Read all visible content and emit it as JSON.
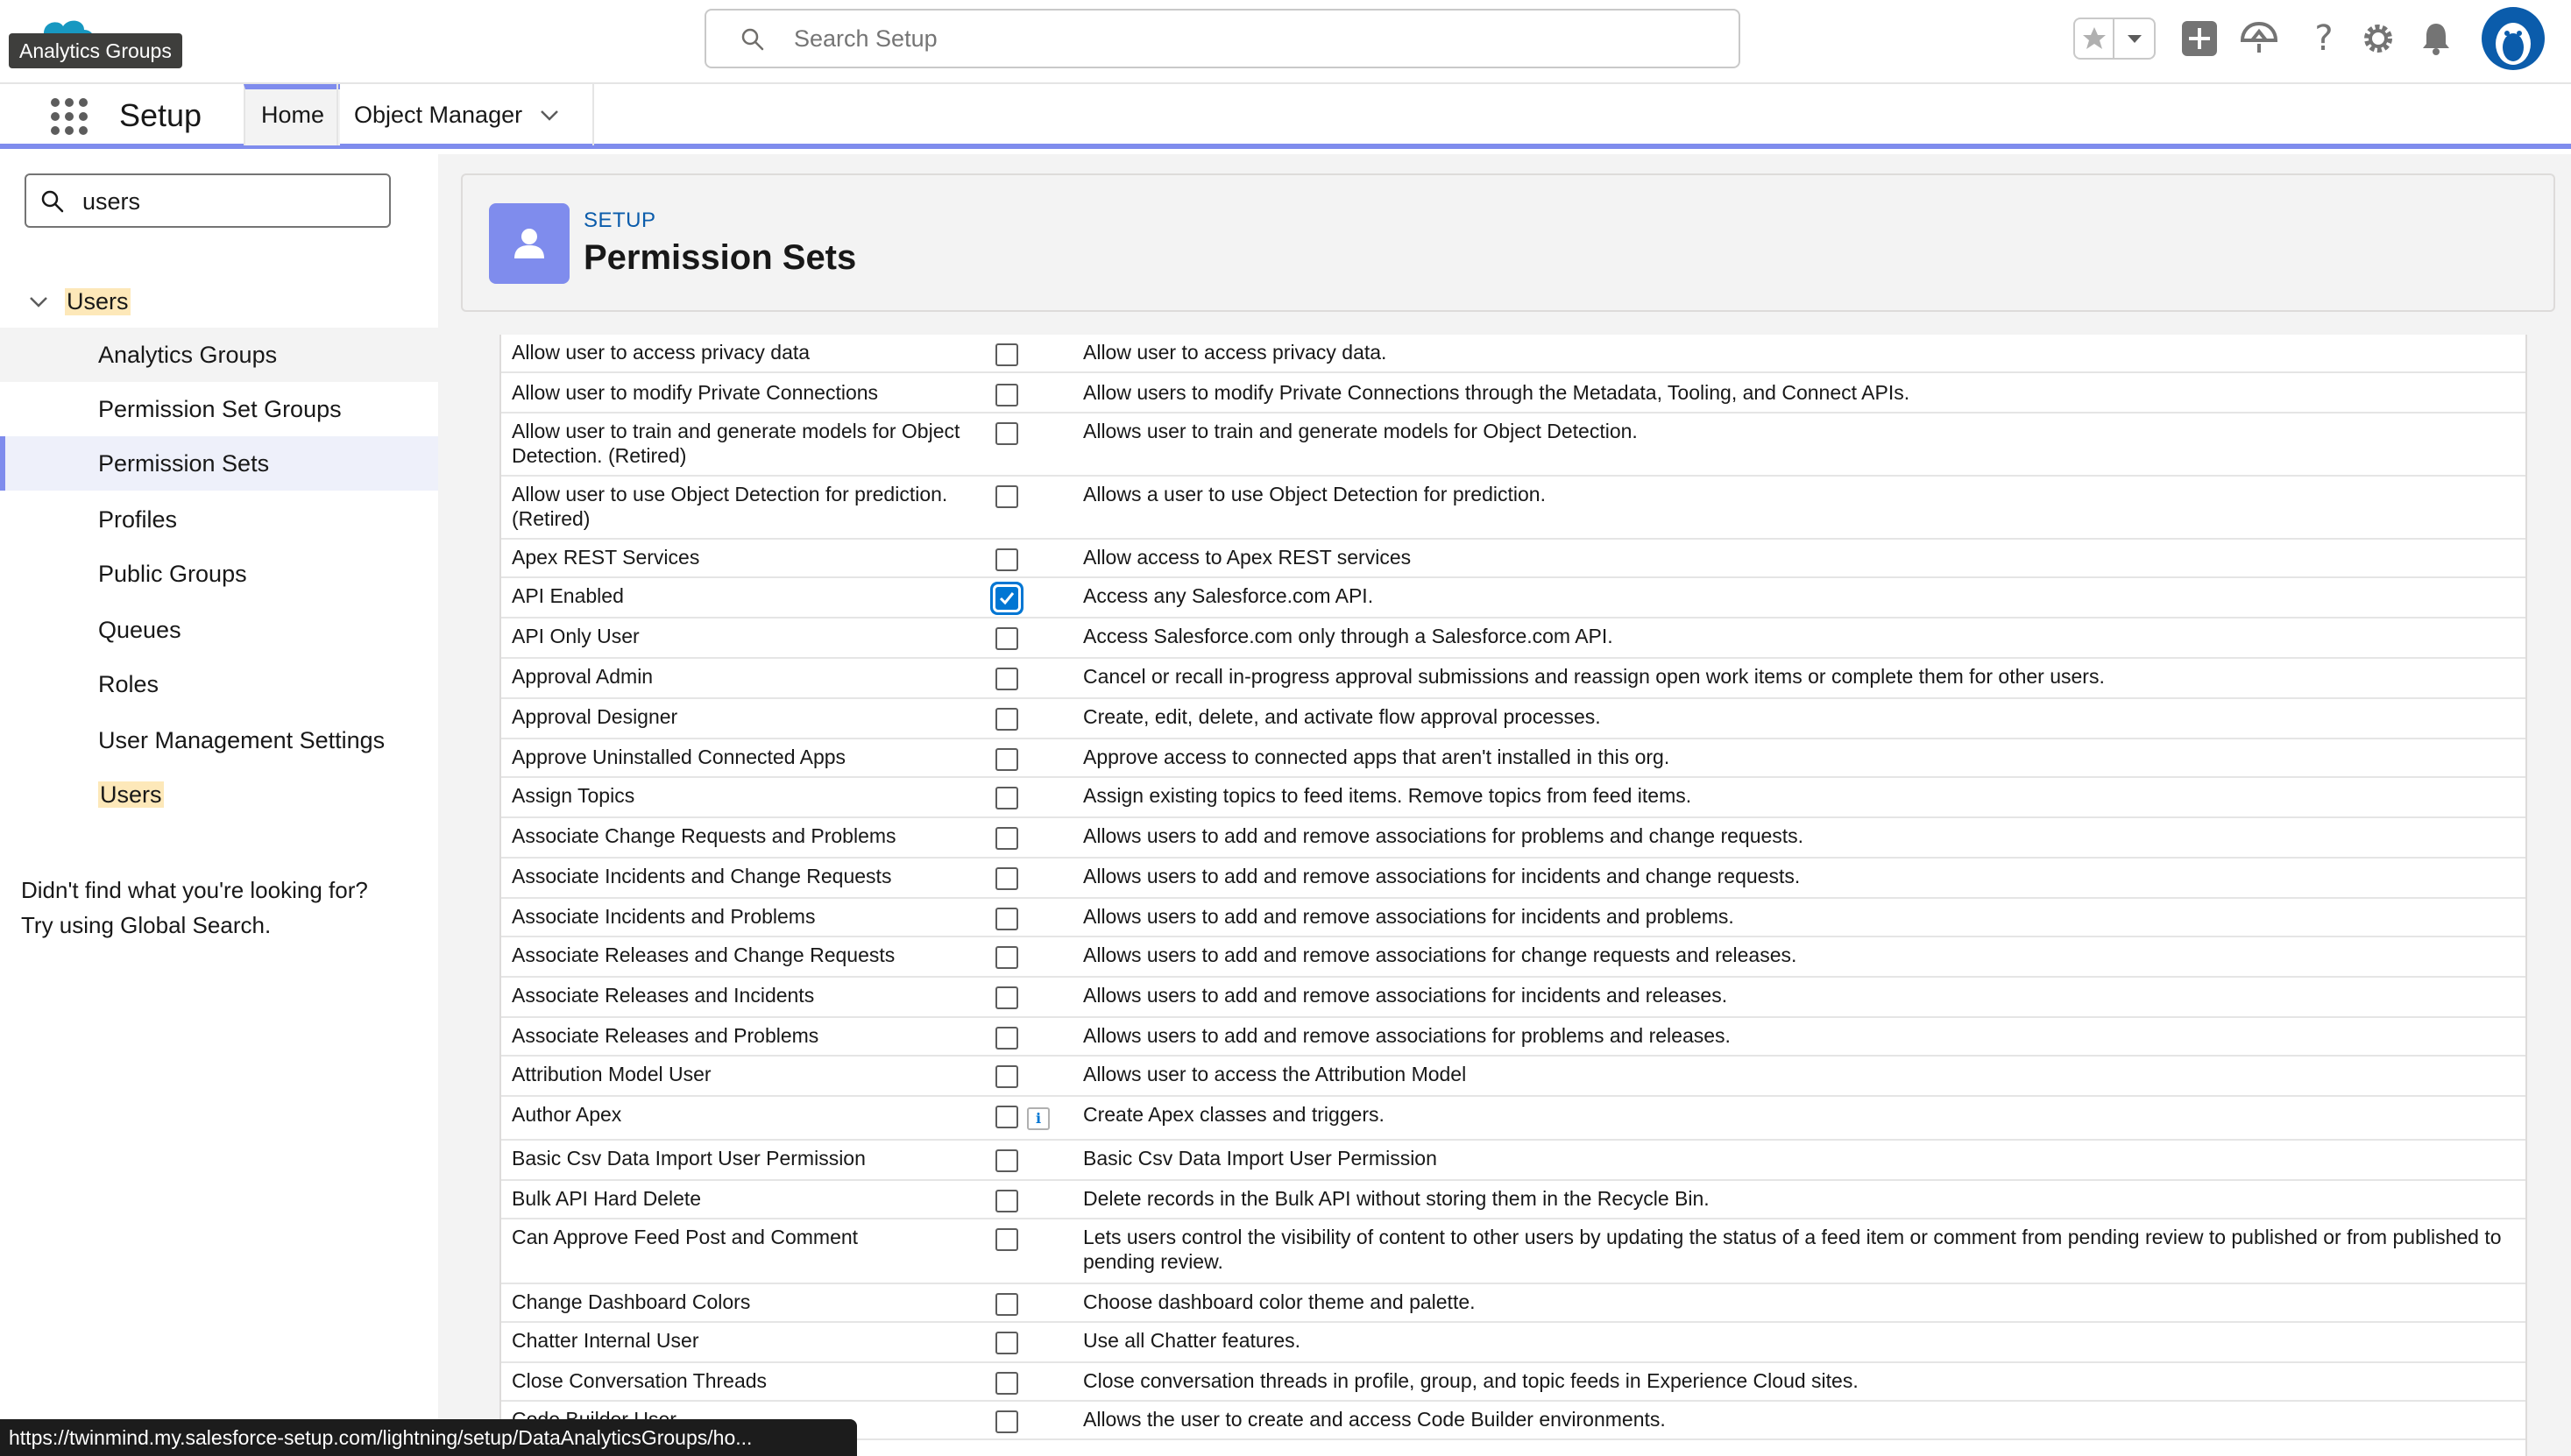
{
  "tooltip": "Analytics Groups",
  "search": {
    "placeholder": "Search Setup"
  },
  "context_bar": {
    "app_name": "Setup",
    "tabs": [
      {
        "label": "Home",
        "active": true
      },
      {
        "label": "Object Manager",
        "active": false
      }
    ]
  },
  "left_nav": {
    "quickfind_value": "users",
    "root_label": "Users",
    "items": [
      {
        "label": "Analytics Groups",
        "state": "hover"
      },
      {
        "label": "Permission Set Groups",
        "state": ""
      },
      {
        "label": "Permission Sets",
        "state": "selected"
      },
      {
        "label": "Profiles",
        "state": ""
      },
      {
        "label": "Public Groups",
        "state": ""
      },
      {
        "label": "Queues",
        "state": ""
      },
      {
        "label": "Roles",
        "state": ""
      },
      {
        "label": "User Management Settings",
        "state": ""
      },
      {
        "label": "Users",
        "state": "highlight"
      }
    ],
    "not_found_line1": "Didn't find what you're looking for?",
    "not_found_line2": "Try using Global Search."
  },
  "page_header": {
    "eyebrow": "SETUP",
    "title": "Permission Sets"
  },
  "permissions": [
    {
      "name": "Allow user to access privacy data",
      "checked": false,
      "desc": "Allow user to access privacy data."
    },
    {
      "name": "Allow user to modify Private Connections",
      "checked": false,
      "desc": "Allow users to modify Private Connections through the Metadata, Tooling, and Connect APIs."
    },
    {
      "name": "Allow user to train and generate models for Object Detection. (Retired)",
      "checked": false,
      "desc": "Allows user to train and generate models for Object Detection."
    },
    {
      "name": "Allow user to use Object Detection for prediction. (Retired)",
      "checked": false,
      "desc": "Allows a user to use Object Detection for prediction."
    },
    {
      "name": "Apex REST Services",
      "checked": false,
      "desc": "Allow access to Apex REST services"
    },
    {
      "name": "API Enabled",
      "checked": true,
      "desc": "Access any Salesforce.com API."
    },
    {
      "name": "API Only User",
      "checked": false,
      "desc": "Access Salesforce.com only through a Salesforce.com API."
    },
    {
      "name": "Approval Admin",
      "checked": false,
      "desc": "Cancel or recall in-progress approval submissions and reassign open work items or complete them for other users."
    },
    {
      "name": "Approval Designer",
      "checked": false,
      "desc": "Create, edit, delete, and activate flow approval processes."
    },
    {
      "name": "Approve Uninstalled Connected Apps",
      "checked": false,
      "desc": "Approve access to connected apps that aren't installed in this org."
    },
    {
      "name": "Assign Topics",
      "checked": false,
      "desc": "Assign existing topics to feed items. Remove topics from feed items."
    },
    {
      "name": "Associate Change Requests and Problems",
      "checked": false,
      "desc": "Allows users to add and remove associations for problems and change requests."
    },
    {
      "name": "Associate Incidents and Change Requests",
      "checked": false,
      "desc": "Allows users to add and remove associations for incidents and change requests."
    },
    {
      "name": "Associate Incidents and Problems",
      "checked": false,
      "desc": "Allows users to add and remove associations for incidents and problems."
    },
    {
      "name": "Associate Releases and Change Requests",
      "checked": false,
      "desc": "Allows users to add and remove associations for change requests and releases."
    },
    {
      "name": "Associate Releases and Incidents",
      "checked": false,
      "desc": "Allows users to add and remove associations for incidents and releases."
    },
    {
      "name": "Associate Releases and Problems",
      "checked": false,
      "desc": "Allows users to add and remove associations for problems and releases."
    },
    {
      "name": "Attribution Model User",
      "checked": false,
      "desc": "Allows user to access the Attribution Model"
    },
    {
      "name": "Author Apex",
      "checked": false,
      "info": true,
      "desc": "Create Apex classes and triggers."
    },
    {
      "name": "Basic Csv Data Import User Permission",
      "checked": false,
      "desc": "Basic Csv Data Import User Permission"
    },
    {
      "name": "Bulk API Hard Delete",
      "checked": false,
      "desc": "Delete records in the Bulk API without storing them in the Recycle Bin."
    },
    {
      "name": "Can Approve Feed Post and Comment",
      "checked": false,
      "desc": "Lets users control the visibility of content to other users by updating the status of a feed item or comment from pending review to published or from published to pending review."
    },
    {
      "name": "Change Dashboard Colors",
      "checked": false,
      "desc": "Choose dashboard color theme and palette."
    },
    {
      "name": "Chatter Internal User",
      "checked": false,
      "desc": "Use all Chatter features."
    },
    {
      "name": "Close Conversation Threads",
      "checked": false,
      "desc": "Close conversation threads in profile, group, and topic feeds in Experience Cloud sites."
    },
    {
      "name": "Code Builder User",
      "checked": false,
      "desc": "Allows the user to create and access Code Builder environments."
    }
  ],
  "status_url": "https://twinmind.my.salesforce-setup.com/lightning/setup/DataAnalyticsGroups/ho...",
  "colors": {
    "accent": "#7f8ced",
    "brand_blue": "#0176d3",
    "highlight": "#fde8b9"
  }
}
